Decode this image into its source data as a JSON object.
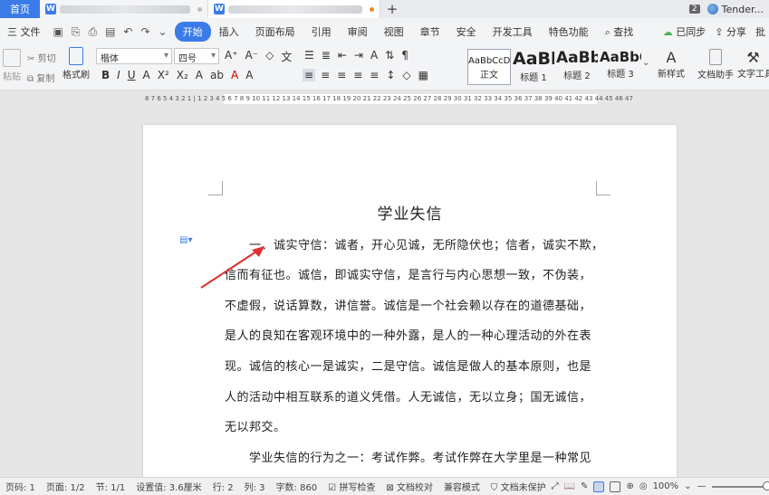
{
  "tabs": {
    "home": "首页",
    "plus": "+",
    "window_count": "2",
    "user": "Tender..."
  },
  "menu": {
    "file": "三 文件",
    "items": [
      "开始",
      "插入",
      "页面布局",
      "引用",
      "审阅",
      "视图",
      "章节",
      "安全",
      "开发工具",
      "特色功能"
    ],
    "search": "查找",
    "sync": "已同步",
    "share": "分享",
    "batch": "批"
  },
  "ribbon": {
    "paste": "粘贴",
    "cut": "剪切",
    "copy": "复制",
    "format_painter": "格式刷",
    "font_family": "楷体",
    "font_size": "四号",
    "styles": [
      {
        "preview": "AaBbCcDd",
        "label": "正文"
      },
      {
        "preview": "AaBb",
        "label": "标题 1"
      },
      {
        "preview": "AaBb(",
        "label": "标题 2"
      },
      {
        "preview": "AaBbC",
        "label": "标题 3"
      }
    ],
    "new_style": "新样式",
    "doc_assistant": "文档助手",
    "text_tools": "文字工具"
  },
  "ruler": {
    "numbers": "8 7 6 5 4 3 2 1 | 1 2 3 4 5 6 7 8 9 10 11 12 13 14 15 16 17 18 19 20 21 22 23 24 25 26 27 28 29 30 31 32 33 34 35 36 37 38 39 40 41 42 43 44 45 46 47"
  },
  "document": {
    "title": "学业失信",
    "lines": [
      "一、诚实守信：诚者，开心见诚，无所隐伏也；信者，诚实不欺，",
      "信而有征也。诚信，即诚实守信，是言行与内心思想一致，不伪装，",
      "不虚假，说话算数，讲信誉。诚信是一个社会赖以存在的道德基础，",
      "是人的良知在客观环境中的一种外露，是人的一种心理活动的外在表",
      "现。诚信的核心一是诚实，二是守信。诚信是做人的基本原则，也是",
      "人的活动中相互联系的道义凭借。人无诚信，无以立身；国无诚信，",
      "无以邦交。",
      "学业失信的行为之一：考试作弊。考试作弊在大学里是一种常见"
    ]
  },
  "status": {
    "page_code": "页码: 1",
    "page": "页面: 1/2",
    "section": "节: 1/1",
    "setting": "设置值: 3.6厘米",
    "row": "行: 2",
    "col": "列: 3",
    "word_count": "字数: 860",
    "spell_check": "拼写检查",
    "doc_check": "文档校对",
    "compat": "兼容模式",
    "unprotected": "文档未保护",
    "zoom": "100%"
  },
  "colors": {
    "accent": "#3b7be8",
    "arrow": "#e03030"
  }
}
